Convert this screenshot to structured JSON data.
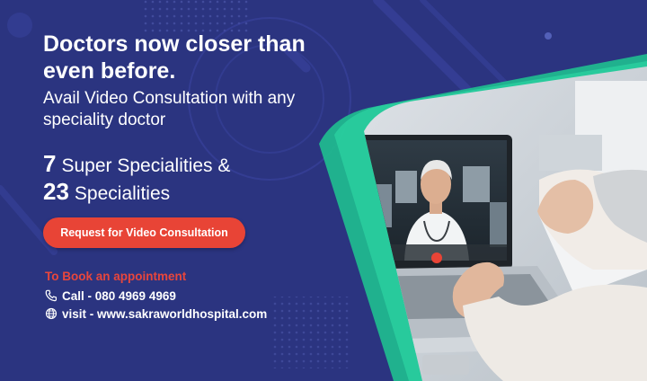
{
  "headline": "Doctors now closer than even before.",
  "subline": "Avail Video Consultation with any speciality doctor",
  "specialities": [
    {
      "number": "7",
      "label": "Super Specialities &"
    },
    {
      "number": "23",
      "label": "Specialities"
    }
  ],
  "cta_label": "Request for Video Consultation",
  "booking": {
    "title": "To Book an appointment",
    "phone": "Call - 080 4969 4969",
    "website": "visit - www.sakraworldhospital.com"
  },
  "colors": {
    "background": "#2b3480",
    "cta": "#e84436",
    "accent_green": "#1fbf8f",
    "booking_title": "#e8463c"
  },
  "icons": [
    "phone-icon",
    "globe-icon",
    "hangup-icon"
  ]
}
